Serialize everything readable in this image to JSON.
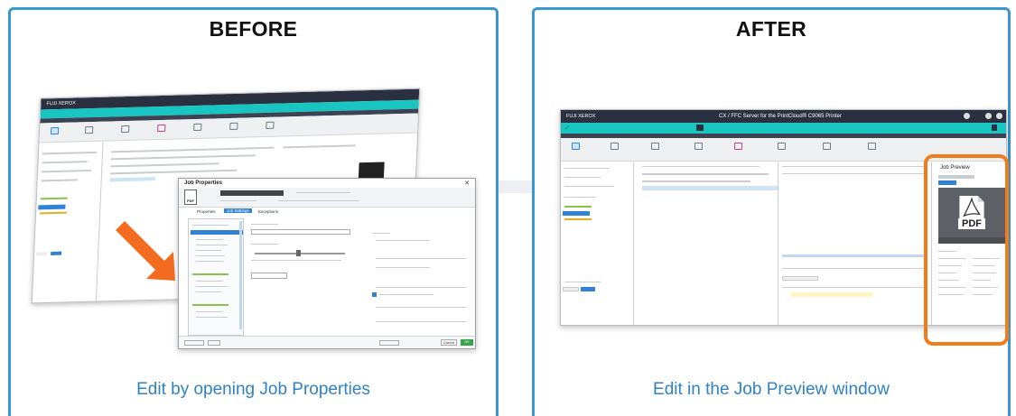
{
  "before": {
    "title": "BEFORE",
    "caption": "Edit by opening Job Properties",
    "dialog": {
      "title": "Job Properties",
      "pdf_label": "PDF",
      "tabs": [
        "Properties",
        "Job Settings",
        "Exceptions"
      ],
      "cancel_label": "Cancel",
      "ok_label": "OK"
    }
  },
  "after": {
    "title": "AFTER",
    "caption": "Edit in the Job Preview window",
    "window_title": "CX / FFC Server for the PrintCloud® C9065 Printer",
    "preview": {
      "header": "Job Preview",
      "pdf_label": "PDF"
    }
  },
  "colors": {
    "panel_border": "#3a97d4",
    "caption_text": "#2f82c5",
    "arrow": "#f26b1f",
    "highlight": "#f07d1a",
    "teal_bar": "#19c5c0",
    "dark_bar": "#2b3040"
  }
}
